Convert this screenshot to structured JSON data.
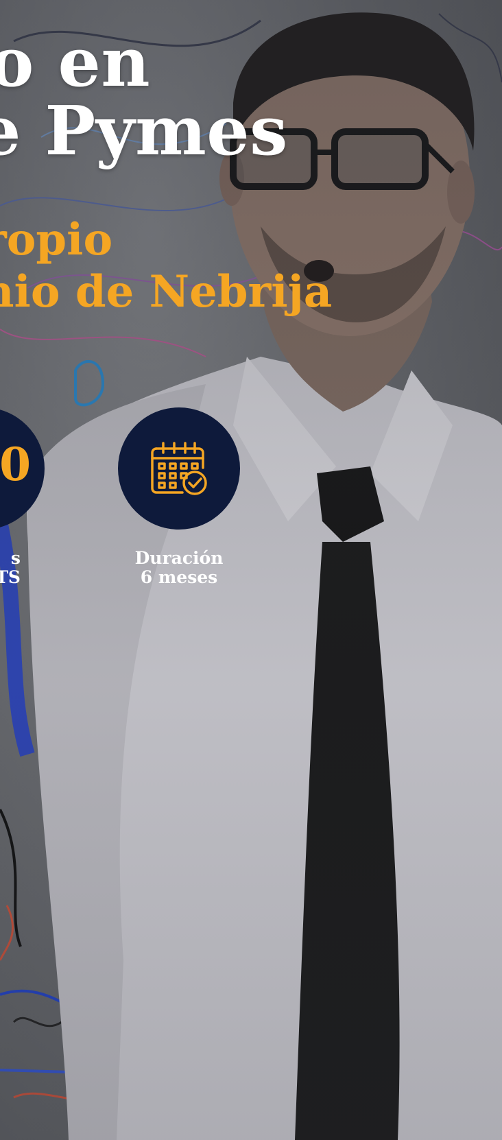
{
  "hero": {
    "title_line1": "o en",
    "title_line2": "e Pymes",
    "subtitle_line1": "ropio",
    "subtitle_line2": "nio de Nebrija"
  },
  "stats": [
    {
      "number": "0",
      "label_line1": "s",
      "label_line2": "TS"
    },
    {
      "icon": "calendar-check-icon",
      "label_line1": "Duración",
      "label_line2": "6 meses"
    }
  ],
  "colors": {
    "accent": "#f5a623",
    "circle": "#0e1a3b",
    "title": "#ffffff"
  }
}
